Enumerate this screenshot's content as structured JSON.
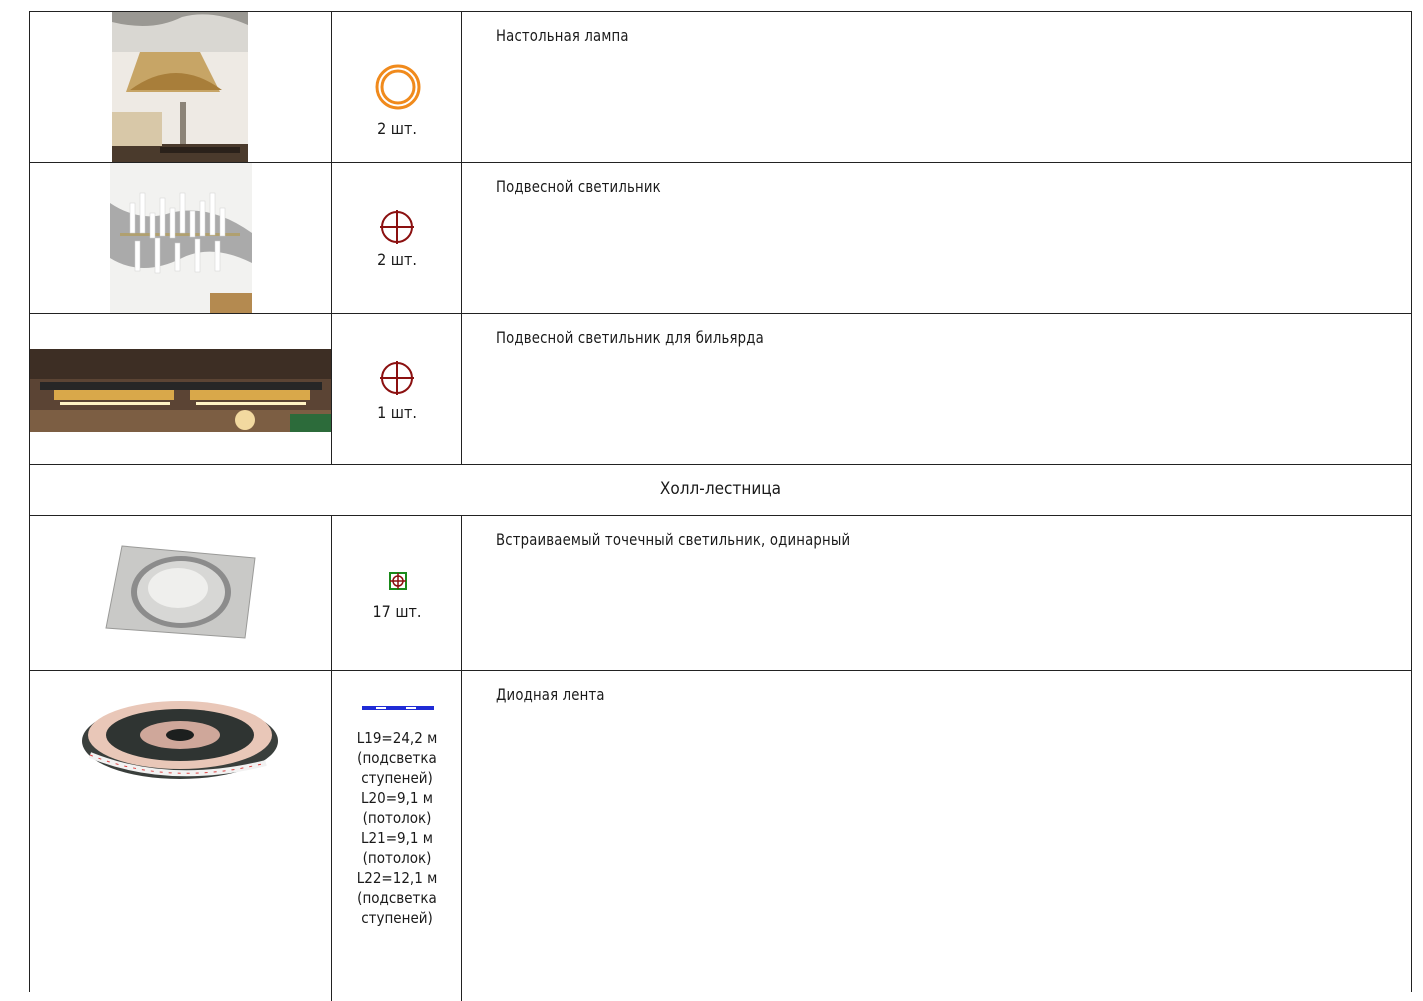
{
  "rows": [
    {
      "description": "Настольная лампа",
      "quantity": "2 шт.",
      "symbol": "double-ring-orange-icon"
    },
    {
      "description": "Подвесной светильник",
      "quantity": "2 шт.",
      "symbol": "crosshair-circle-red-icon"
    },
    {
      "description": "Подвесной светильник для бильярда",
      "quantity": "1 шт.",
      "symbol": "crosshair-circle-red-icon"
    },
    {
      "description": "Встраиваемый точечный светильник, одинарный",
      "quantity": "17 шт.",
      "symbol": "square-crosshair-green-icon"
    },
    {
      "description": "Диодная лента",
      "symbol": "dashed-line-blue-icon"
    }
  ],
  "section_title": "Холл-лестница",
  "led_lengths": [
    "L19=24,2 м",
    "(подсветка",
    "ступеней)",
    "L20=9,1 м",
    "(потолок)",
    "L21=9,1 м",
    "(потолок)",
    "L22=12,1 м",
    "(подсветка",
    "ступеней)"
  ],
  "colors": {
    "orange": "#f08a1c",
    "red": "#8b1010",
    "green": "#1a8a1a",
    "blue": "#1f2bd6"
  }
}
